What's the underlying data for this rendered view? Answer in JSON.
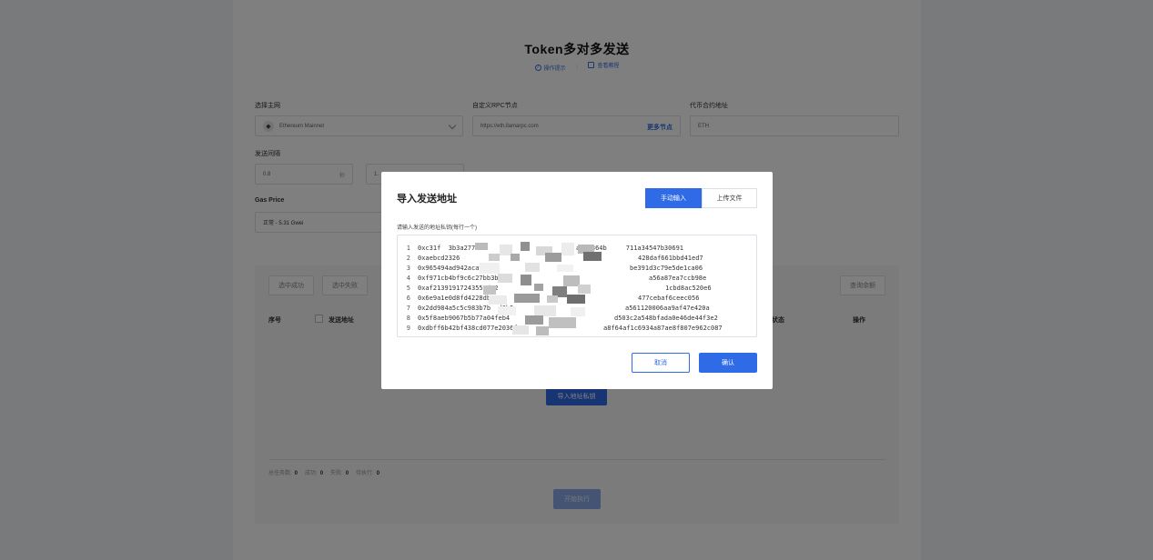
{
  "page": {
    "title": "Token多对多发送",
    "hint_link": "操作提示",
    "tutorial_link": "查看教程"
  },
  "form": {
    "network_label": "选择主网",
    "network_value": "Ethereum Mainnet",
    "rpc_label": "自定义RPC节点",
    "rpc_value": "https://eth.llamarpc.com",
    "more_nodes": "更多节点",
    "contract_label": "代币合约地址",
    "contract_value": "ETH",
    "interval_label": "发送间隔",
    "interval_value": "0.8",
    "interval_unit": "秒",
    "interval_value2": "1.",
    "gas_label": "Gas Price",
    "gas_value": "正常 - 5.31 Gwei"
  },
  "table": {
    "select_success": "选中成功",
    "select_fail": "选中失败",
    "query_balance": "查询余额",
    "col_index": "序号",
    "col_address": "发送地址",
    "col_status": "状态",
    "col_action": "操作",
    "import_button": "导入地址私钥",
    "stats": [
      {
        "label": "总任务数:",
        "value": "0"
      },
      {
        "label": "成功:",
        "value": "0"
      },
      {
        "label": "失败:",
        "value": "0"
      },
      {
        "label": "待执行:",
        "value": "0"
      }
    ],
    "start_button": "开始执行"
  },
  "modal": {
    "title": "导入发送地址",
    "tab_manual": "手动输入",
    "tab_upload": "上传文件",
    "input_label": "请输入发送的地址私钥(每行一个)",
    "lines": [
      {
        "n": "1",
        "left": "0xc31f  3b3a2774",
        "right": "a544364b     711a34547b30691"
      },
      {
        "n": "2",
        "left": "0xaebcd2326",
        "right": "428daf661bbd41ed7"
      },
      {
        "n": "3",
        "left": "0x965494ad942aca9545",
        "right": "be391d3c79e5de1ca06"
      },
      {
        "n": "4",
        "left": "0xf971cb4bf9c6c27bb3b0",
        "right": "a56a87ea7ccb98e"
      },
      {
        "n": "5",
        "left": "0xaf21391917243553d32",
        "right": "1cbd8ac520e6"
      },
      {
        "n": "6",
        "left": "0x6e9a1e0d8fd4228db9",
        "right": "477cebaf6ceec056"
      },
      {
        "n": "7",
        "left": "0x2dd984a5c5c983b7b  d0b5",
        "right": "a561120006aa9af47e420a"
      },
      {
        "n": "8",
        "left": "0x5f8aeb9067b5b77a04feb4",
        "right": "d503c2a548bfada0e46de44f3e2"
      },
      {
        "n": "9",
        "left": "0xdbff6b42bf438cd077e2036f",
        "right": "a8f64af1c6934a87ae8f807e962c087"
      }
    ],
    "cancel": "取消",
    "confirm": "确认"
  },
  "colors": {
    "primary": "#2f6be6",
    "overlay": "rgba(0,0,0,0.5)"
  }
}
